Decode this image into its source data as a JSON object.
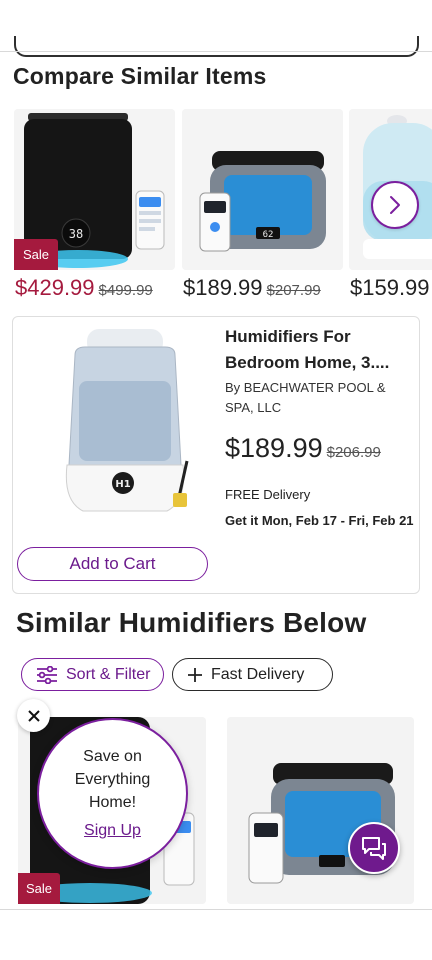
{
  "compare": {
    "heading": "Compare Similar Items",
    "items": [
      {
        "price": "$429.99",
        "was": "$499.99",
        "badge": "Sale"
      },
      {
        "price": "$189.99",
        "was": "$207.99"
      },
      {
        "price": "$159.99"
      }
    ]
  },
  "product": {
    "title": "Humidifiers For Bedroom Home, 3....",
    "brand": "By BEACHWATER POOL & SPA, LLC",
    "price": "$189.99",
    "was": "$206.99",
    "delivery": "FREE Delivery",
    "eta": "Get it Mon, Feb 17 - Fri, Feb 21",
    "add_to_cart": "Add to Cart",
    "display_text": "H1"
  },
  "similar": {
    "heading": "Similar Humidifiers Below",
    "sort_filter": "Sort & Filter",
    "fast_delivery": "Fast Delivery",
    "badge": "Sale"
  },
  "promo": {
    "line1": "Save on",
    "line2": "Everything",
    "line3": "Home!",
    "link": "Sign Up"
  },
  "display_values": {
    "black_unit": "38",
    "silver_unit": "62"
  },
  "icons": {
    "carousel_next": "chevron-right-icon",
    "sort": "sliders-icon",
    "fast": "plus-icon",
    "close": "close-icon",
    "chat": "chat-icon"
  },
  "colors": {
    "brand": "#7b1f9e",
    "sale": "#a51a3e"
  }
}
